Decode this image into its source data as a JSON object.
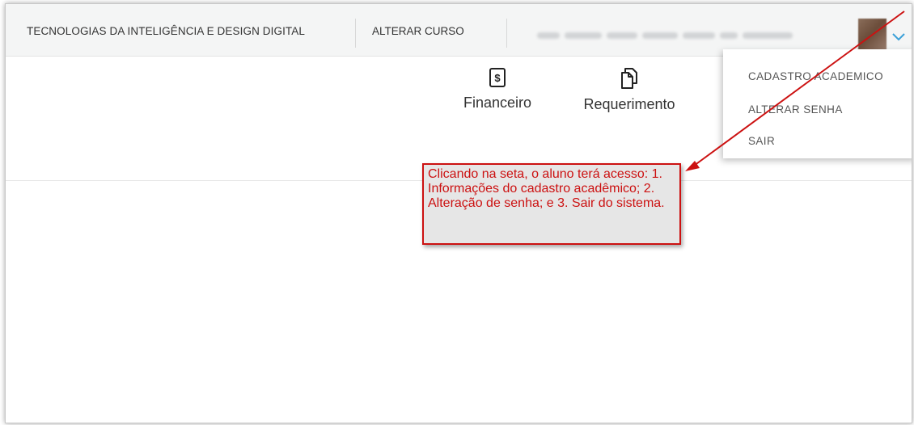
{
  "topbar": {
    "course_name": "TECNOLOGIAS DA INTELIGÊNCIA E DESIGN DIGITAL",
    "change_course_label": "ALTERAR CURSO",
    "expand_icon": "chevron-down-icon"
  },
  "quick_actions": [
    {
      "label": "Financeiro",
      "icon": "dollar-document-icon"
    },
    {
      "label": "Requerimento",
      "icon": "documents-icon"
    }
  ],
  "user_menu": {
    "items": [
      "CADASTRO ACADEMICO",
      "ALTERAR SENHA",
      "SAIR"
    ]
  },
  "annotation": {
    "text": "Clicando na seta, o aluno terá acesso: 1. Informações do cadastro acadêmico; 2. Alteração de senha; e 3. Sair do sistema.",
    "color": "#cc1111"
  },
  "colors": {
    "chevron": "#3aa0d8",
    "topbar_bg": "#f4f5f5"
  }
}
